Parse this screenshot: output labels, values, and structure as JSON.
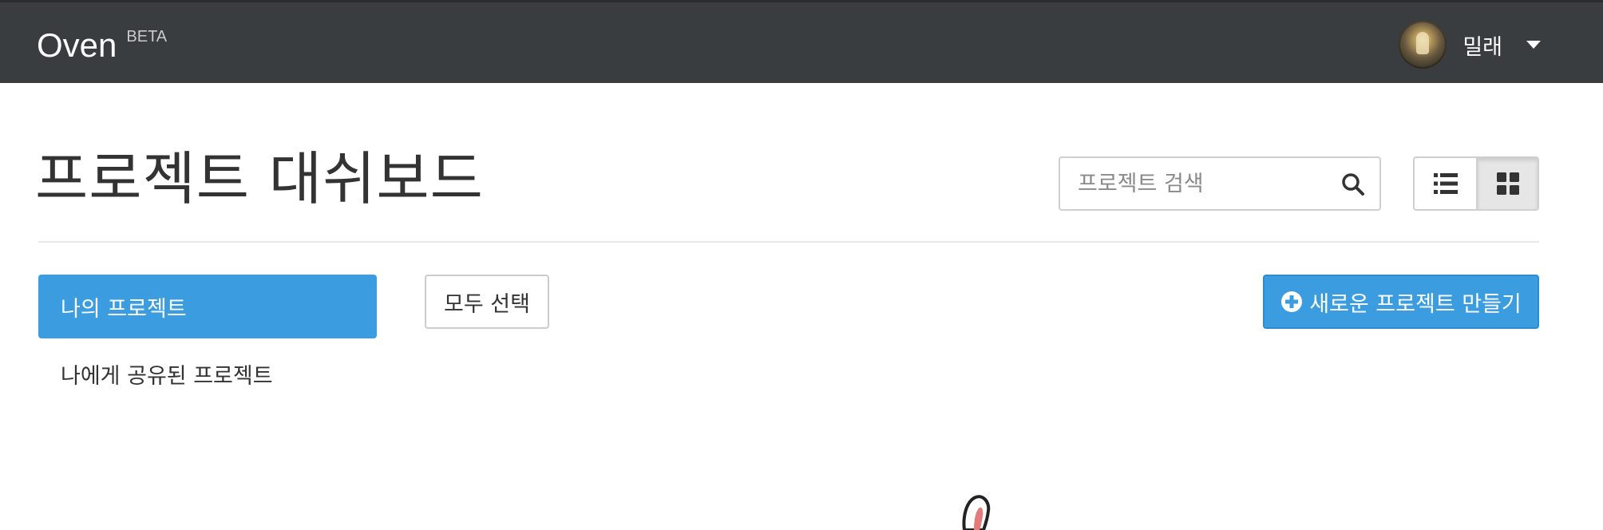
{
  "navbar": {
    "brand": "Oven",
    "badge": "BETA",
    "user_name": "밀래",
    "avatar_icon": "avatar-image",
    "caret_icon": "caret-down-icon",
    "background": "#3a3d40"
  },
  "header": {
    "title": "프로젝트 대쉬보드",
    "search_placeholder": "프로젝트 검색",
    "search_icon": "search-icon",
    "view_list_icon": "list-icon",
    "view_grid_icon": "grid-icon",
    "active_view": "grid"
  },
  "sidebar": {
    "items": [
      {
        "label": "나의 프로젝트",
        "active": true
      },
      {
        "label": "나에게 공유된 프로젝트",
        "active": false
      }
    ]
  },
  "toolbar": {
    "select_all_label": "모두 선택",
    "new_project_label": "새로운 프로젝트 만들기",
    "new_project_icon": "plus-circle-icon"
  },
  "colors": {
    "accent": "#3b9de0",
    "navbar": "#3a3d40",
    "text": "#333333"
  }
}
